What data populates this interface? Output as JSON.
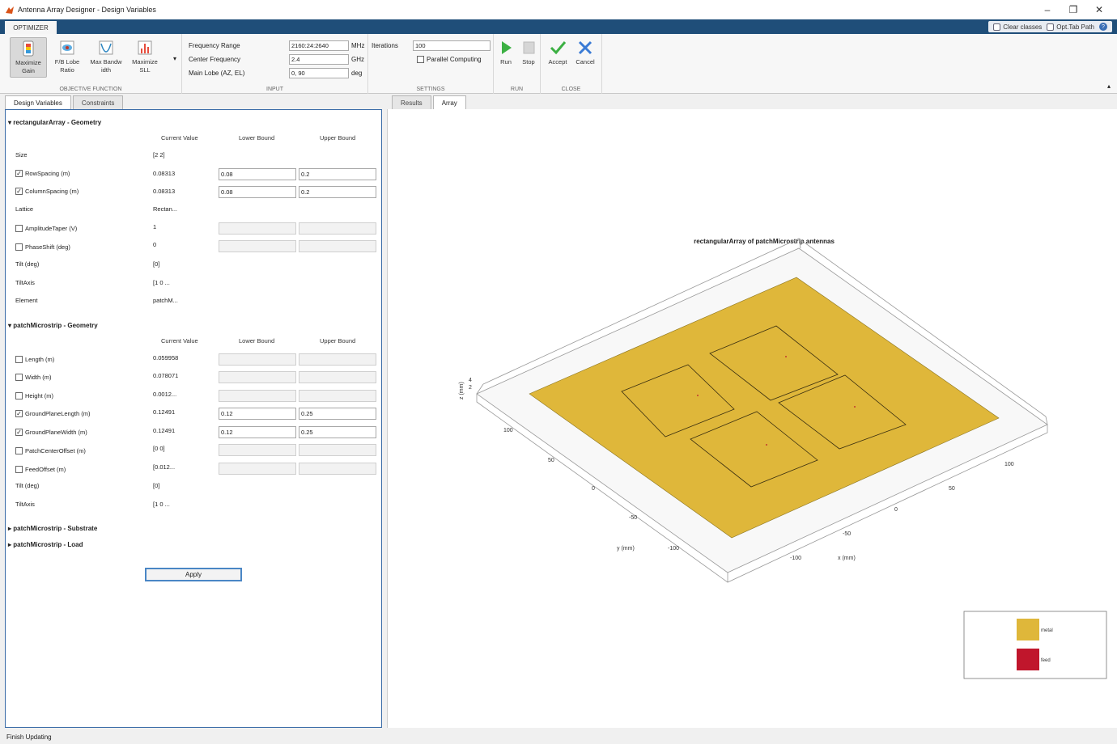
{
  "window": {
    "title": "Antenna Array Designer - Design Variables",
    "minimize": "–",
    "restore": "❐",
    "close": "✕"
  },
  "ribbon_tab": "OPTIMIZER",
  "quick_access": {
    "clear_classes": "Clear classes",
    "opt_tab_path": "Opt.Tab Path",
    "help": "?"
  },
  "objective": {
    "label": "OBJECTIVE FUNCTION",
    "buttons": [
      {
        "label1": "Maximize",
        "label2": "Gain"
      },
      {
        "label1": "F/B Lobe",
        "label2": "Ratio"
      },
      {
        "label1": "Max Bandw",
        "label2": "idth"
      },
      {
        "label1": "Maximize",
        "label2": "SLL"
      }
    ]
  },
  "input": {
    "label": "INPUT",
    "freq_range_label": "Frequency Range",
    "freq_range_value": "2160:24:2640",
    "freq_range_unit": "MHz",
    "center_freq_label": "Center Frequency",
    "center_freq_value": "2.4",
    "center_freq_unit": "GHz",
    "main_lobe_label": "Main Lobe (AZ, EL)",
    "main_lobe_value": "0, 90",
    "main_lobe_unit": "deg"
  },
  "settings": {
    "label": "SETTINGS",
    "iterations_label": "Iterations",
    "iterations_value": "100",
    "parallel_label": "Parallel Computing"
  },
  "run": {
    "label": "RUN",
    "run": "Run",
    "stop": "Stop"
  },
  "close": {
    "label": "CLOSE",
    "accept": "Accept",
    "cancel": "Cancel"
  },
  "left_tabs": {
    "design": "Design Variables",
    "constraints": "Constraints"
  },
  "right_tabs": {
    "results": "Results",
    "array": "Array"
  },
  "columns": {
    "current": "Current Value",
    "lower": "Lower Bound",
    "upper": "Upper Bound"
  },
  "sections": {
    "rect": "rectangularArray - Geometry",
    "patch": "patchMicrostrip - Geometry",
    "substrate": "patchMicrostrip - Substrate",
    "load": "patchMicrostrip - Load"
  },
  "rect_rows": [
    {
      "label": "Size",
      "value": "[2 2]"
    },
    {
      "label": "RowSpacing (m)",
      "value": "0.08313",
      "lower": "0.08",
      "upper": "0.2",
      "checked": "✓"
    },
    {
      "label": "ColumnSpacing (m)",
      "value": "0.08313",
      "lower": "0.08",
      "upper": "0.2",
      "checked": "✓"
    },
    {
      "label": "Lattice",
      "value": "Rectan..."
    },
    {
      "label": "AmplitudeTaper (V)",
      "value": "1"
    },
    {
      "label": "PhaseShift (deg)",
      "value": "0"
    },
    {
      "label": "Tilt (deg)",
      "value": "[0]"
    },
    {
      "label": "TiltAxis",
      "value": "[1 0 ..."
    },
    {
      "label": "Element",
      "value": "patchM..."
    }
  ],
  "patch_rows": [
    {
      "label": "Length (m)",
      "value": "0.059958"
    },
    {
      "label": "Width (m)",
      "value": "0.078071"
    },
    {
      "label": "Height (m)",
      "value": "0.0012..."
    },
    {
      "label": "GroundPlaneLength (m)",
      "value": "0.12491",
      "lower": "0.12",
      "upper": "0.25",
      "checked": "✓"
    },
    {
      "label": "GroundPlaneWidth (m)",
      "value": "0.12491",
      "lower": "0.12",
      "upper": "0.25",
      "checked": "✓"
    },
    {
      "label": "PatchCenterOffset (m)",
      "value": "[0 0]"
    },
    {
      "label": "FeedOffset (m)",
      "value": "[0.012..."
    },
    {
      "label": "Tilt (deg)",
      "value": "[0]"
    },
    {
      "label": "TiltAxis",
      "value": "[1 0 ..."
    }
  ],
  "apply": "Apply",
  "plot": {
    "title": "rectangularArray of patchMicrostrip antennas",
    "y_label": "y (mm)",
    "x_label": "x (mm)",
    "z_label": "z (mm)",
    "y_ticks": [
      "100",
      "50",
      "0",
      "-50",
      "-100"
    ],
    "x_ticks": [
      "100",
      "50",
      "0",
      "-50",
      "-100"
    ],
    "z_ticks": [
      "4",
      "2"
    ],
    "metal_color": "#dfb73a",
    "feed_color": "#c0162c",
    "legend": {
      "metal": "metal",
      "feed": "feed"
    }
  },
  "status": "Finish Updating"
}
